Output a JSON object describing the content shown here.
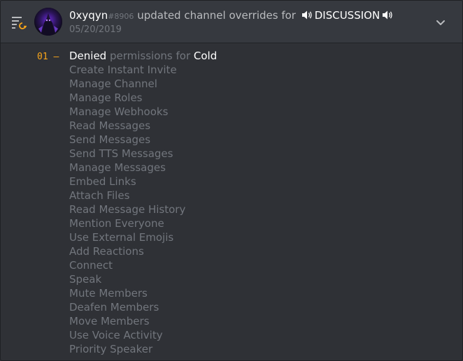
{
  "entry": {
    "action_icon": "channel-override-update-icon",
    "username": "0xyqyn",
    "discriminator": "#8906",
    "action_text": "updated channel overrides for",
    "channel_icon": "speaker-icon",
    "channel_name": "DISCUSSION",
    "date": "05/20/2019",
    "expand_icon": "chevron-down-icon"
  },
  "change": {
    "number": "01",
    "dash": "—",
    "verb": "Denied",
    "middle_text": "permissions for",
    "target": "Cold",
    "permissions": [
      "Create Instant Invite",
      "Manage Channel",
      "Manage Roles",
      "Manage Webhooks",
      "Read Messages",
      "Send Messages",
      "Send TTS Messages",
      "Manage Messages",
      "Embed Links",
      "Attach Files",
      "Read Message History",
      "Mention Everyone",
      "Use External Emojis",
      "Add Reactions",
      "Connect",
      "Speak",
      "Mute Members",
      "Deafen Members",
      "Move Members",
      "Use Voice Activity",
      "Priority Speaker"
    ]
  },
  "colors": {
    "background": "#2f3136",
    "header": "#36393f",
    "accent_orange": "#faa61a",
    "text_white": "#ffffff",
    "text_muted": "#72767d"
  }
}
